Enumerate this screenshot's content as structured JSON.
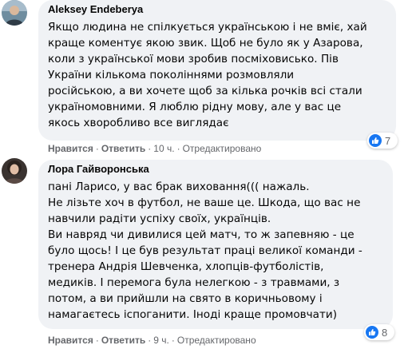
{
  "comments": [
    {
      "author": "Aleksey Endeberya",
      "text_lines": [
        "Якщо людина не спілкується українською і не вміє, хай",
        "краще коментує якою звик. Щоб не було як у Азарова,",
        "коли з української мови зробив посміховисько. Пів",
        "України кількома поколіннями розмовляли",
        "російською, а ви хочете щоб за кілька рочків всі стали",
        "україномовними. Я люблю рідну мову, але у вас це",
        "якось хворобливо все виглядає"
      ],
      "like_label": "Нравится",
      "reply_label": "Ответить",
      "time": "10 ч.",
      "edited": "Отредактировано",
      "reaction_count": "7",
      "reaction_icon": "like-icon"
    },
    {
      "author": "Лора Гайворонська",
      "text_lines": [
        "пані Ларисо, у вас брак виховання((( нажаль.",
        "Не лізьте хоч в футбол, не ваше це. Шкода, що вас не",
        "навчили радіти успіху своїх, українців.",
        "Ви навряд чи дивилися цей матч, то ж запевняю - це",
        "було щось! І це був результат праці великої команди -",
        "тренера Андрія Шевченка, хлопців-футболістів,",
        "медиків. І перемога була нелегкою - з травмами, з",
        "потом, а ви прийшли на свято в коричньовому і",
        "намагаєтесь іспоганити. Іноді краще промовчати)"
      ],
      "like_label": "Нравится",
      "reply_label": "Ответить",
      "time": "9 ч.",
      "edited": "Отредактировано",
      "reaction_count": "8",
      "reaction_icon": "like-icon"
    }
  ],
  "colors": {
    "bubble": "#f0f2f5",
    "meta_text": "#65676b",
    "like_blue": "#1877f2"
  }
}
